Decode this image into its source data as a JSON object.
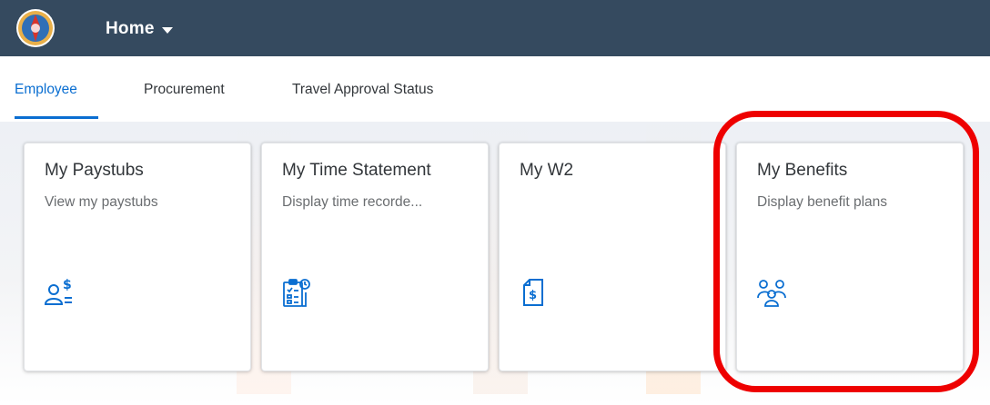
{
  "header": {
    "menu_label": "Home"
  },
  "tabs": [
    {
      "label": "Employee",
      "active": true
    },
    {
      "label": "Procurement",
      "active": false
    },
    {
      "label": "Travel Approval Status",
      "active": false
    }
  ],
  "tiles": [
    {
      "title": "My Paystubs",
      "subtitle": "View my paystubs",
      "icon": "paystub-icon"
    },
    {
      "title": "My Time Statement",
      "subtitle": "Display time recorde...",
      "icon": "time-statement-icon"
    },
    {
      "title": "My W2",
      "subtitle": "",
      "icon": "w2-document-icon"
    },
    {
      "title": "My Benefits",
      "subtitle": "Display benefit plans",
      "icon": "benefits-group-icon"
    }
  ],
  "colors": {
    "shell_bar": "#354a5f",
    "accent_blue": "#0a6ed1",
    "highlight_red": "#ee0000",
    "icon_blue": "#0a6ed1"
  }
}
